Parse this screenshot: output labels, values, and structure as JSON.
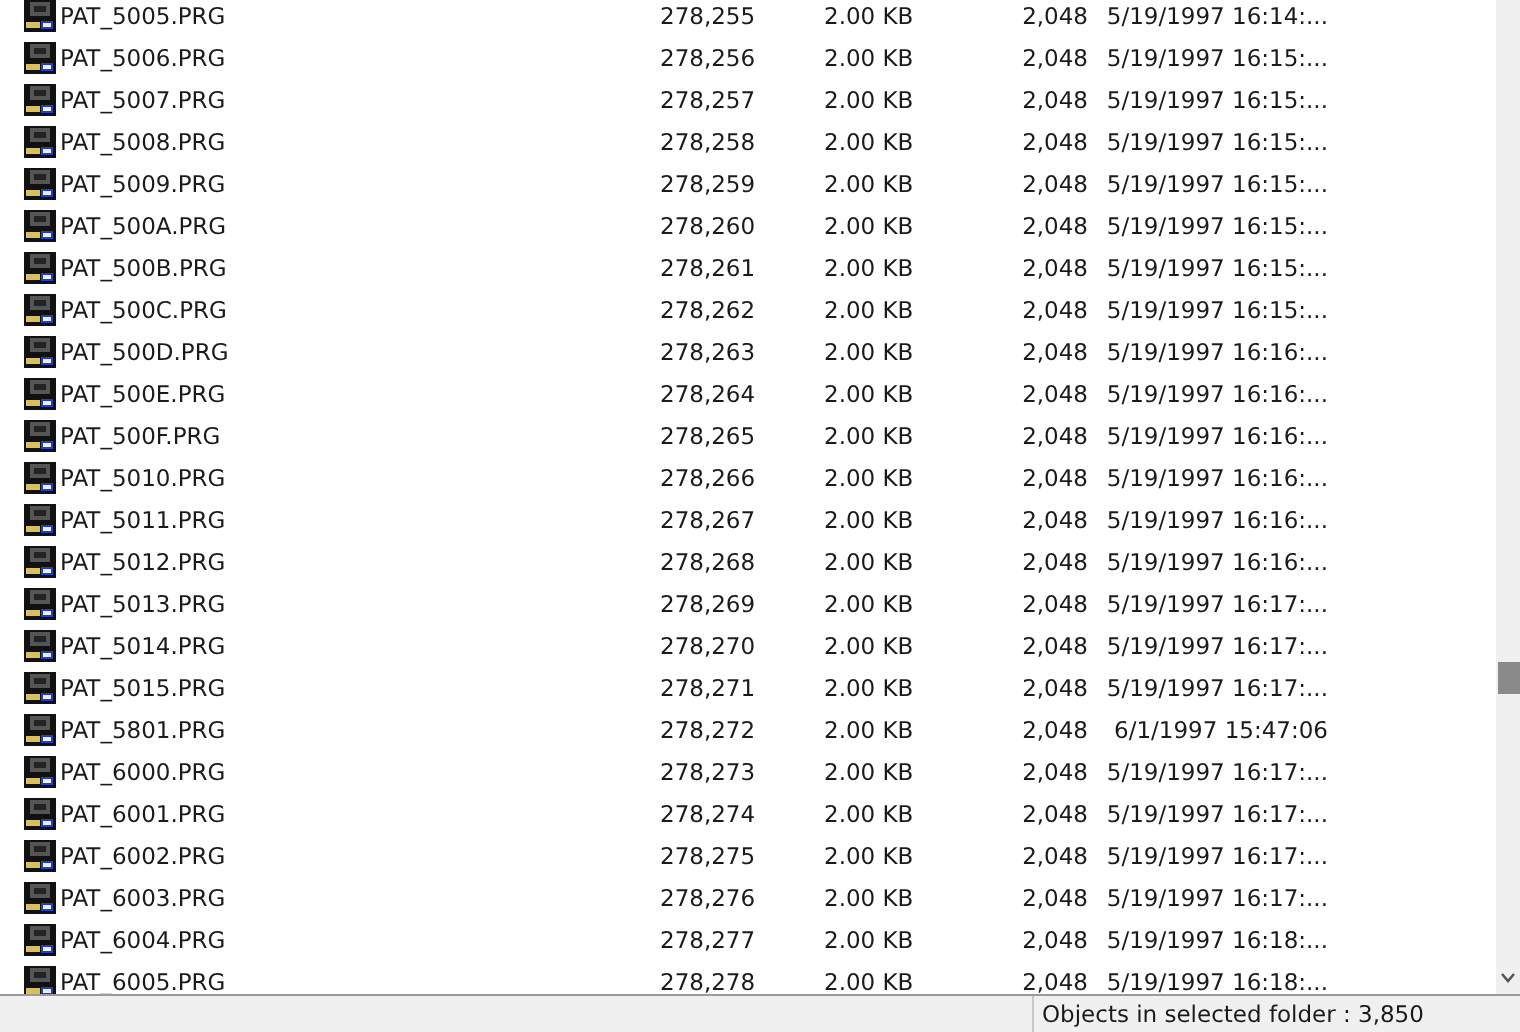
{
  "rows": [
    {
      "name": "PAT_5005.PRG",
      "column_2": "278,255",
      "column_3": "2.00 KB",
      "column_4": "2,048",
      "column_5": "5/19/1997 16:14:..."
    },
    {
      "name": "PAT_5006.PRG",
      "column_2": "278,256",
      "column_3": "2.00 KB",
      "column_4": "2,048",
      "column_5": "5/19/1997 16:15:..."
    },
    {
      "name": "PAT_5007.PRG",
      "column_2": "278,257",
      "column_3": "2.00 KB",
      "column_4": "2,048",
      "column_5": "5/19/1997 16:15:..."
    },
    {
      "name": "PAT_5008.PRG",
      "column_2": "278,258",
      "column_3": "2.00 KB",
      "column_4": "2,048",
      "column_5": "5/19/1997 16:15:..."
    },
    {
      "name": "PAT_5009.PRG",
      "column_2": "278,259",
      "column_3": "2.00 KB",
      "column_4": "2,048",
      "column_5": "5/19/1997 16:15:..."
    },
    {
      "name": "PAT_500A.PRG",
      "column_2": "278,260",
      "column_3": "2.00 KB",
      "column_4": "2,048",
      "column_5": "5/19/1997 16:15:..."
    },
    {
      "name": "PAT_500B.PRG",
      "column_2": "278,261",
      "column_3": "2.00 KB",
      "column_4": "2,048",
      "column_5": "5/19/1997 16:15:..."
    },
    {
      "name": "PAT_500C.PRG",
      "column_2": "278,262",
      "column_3": "2.00 KB",
      "column_4": "2,048",
      "column_5": "5/19/1997 16:15:..."
    },
    {
      "name": "PAT_500D.PRG",
      "column_2": "278,263",
      "column_3": "2.00 KB",
      "column_4": "2,048",
      "column_5": "5/19/1997 16:16:..."
    },
    {
      "name": "PAT_500E.PRG",
      "column_2": "278,264",
      "column_3": "2.00 KB",
      "column_4": "2,048",
      "column_5": "5/19/1997 16:16:..."
    },
    {
      "name": "PAT_500F.PRG",
      "column_2": "278,265",
      "column_3": "2.00 KB",
      "column_4": "2,048",
      "column_5": "5/19/1997 16:16:..."
    },
    {
      "name": "PAT_5010.PRG",
      "column_2": "278,266",
      "column_3": "2.00 KB",
      "column_4": "2,048",
      "column_5": "5/19/1997 16:16:..."
    },
    {
      "name": "PAT_5011.PRG",
      "column_2": "278,267",
      "column_3": "2.00 KB",
      "column_4": "2,048",
      "column_5": "5/19/1997 16:16:..."
    },
    {
      "name": "PAT_5012.PRG",
      "column_2": "278,268",
      "column_3": "2.00 KB",
      "column_4": "2,048",
      "column_5": "5/19/1997 16:16:..."
    },
    {
      "name": "PAT_5013.PRG",
      "column_2": "278,269",
      "column_3": "2.00 KB",
      "column_4": "2,048",
      "column_5": "5/19/1997 16:17:..."
    },
    {
      "name": "PAT_5014.PRG",
      "column_2": "278,270",
      "column_3": "2.00 KB",
      "column_4": "2,048",
      "column_5": "5/19/1997 16:17:..."
    },
    {
      "name": "PAT_5015.PRG",
      "column_2": "278,271",
      "column_3": "2.00 KB",
      "column_4": "2,048",
      "column_5": "5/19/1997 16:17:..."
    },
    {
      "name": "PAT_5801.PRG",
      "column_2": "278,272",
      "column_3": "2.00 KB",
      "column_4": "2,048",
      "column_5": "6/1/1997 15:47:06"
    },
    {
      "name": "PAT_6000.PRG",
      "column_2": "278,273",
      "column_3": "2.00 KB",
      "column_4": "2,048",
      "column_5": "5/19/1997 16:17:..."
    },
    {
      "name": "PAT_6001.PRG",
      "column_2": "278,274",
      "column_3": "2.00 KB",
      "column_4": "2,048",
      "column_5": "5/19/1997 16:17:..."
    },
    {
      "name": "PAT_6002.PRG",
      "column_2": "278,275",
      "column_3": "2.00 KB",
      "column_4": "2,048",
      "column_5": "5/19/1997 16:17:..."
    },
    {
      "name": "PAT_6003.PRG",
      "column_2": "278,276",
      "column_3": "2.00 KB",
      "column_4": "2,048",
      "column_5": "5/19/1997 16:17:..."
    },
    {
      "name": "PAT_6004.PRG",
      "column_2": "278,277",
      "column_3": "2.00 KB",
      "column_4": "2,048",
      "column_5": "5/19/1997 16:18:..."
    },
    {
      "name": "PAT_6005.PRG",
      "column_2": "278,278",
      "column_3": "2.00 KB",
      "column_4": "2,048",
      "column_5": "5/19/1997 16:18:..."
    }
  ],
  "status_bar": {
    "text": "Objects in selected folder : 3,850"
  }
}
